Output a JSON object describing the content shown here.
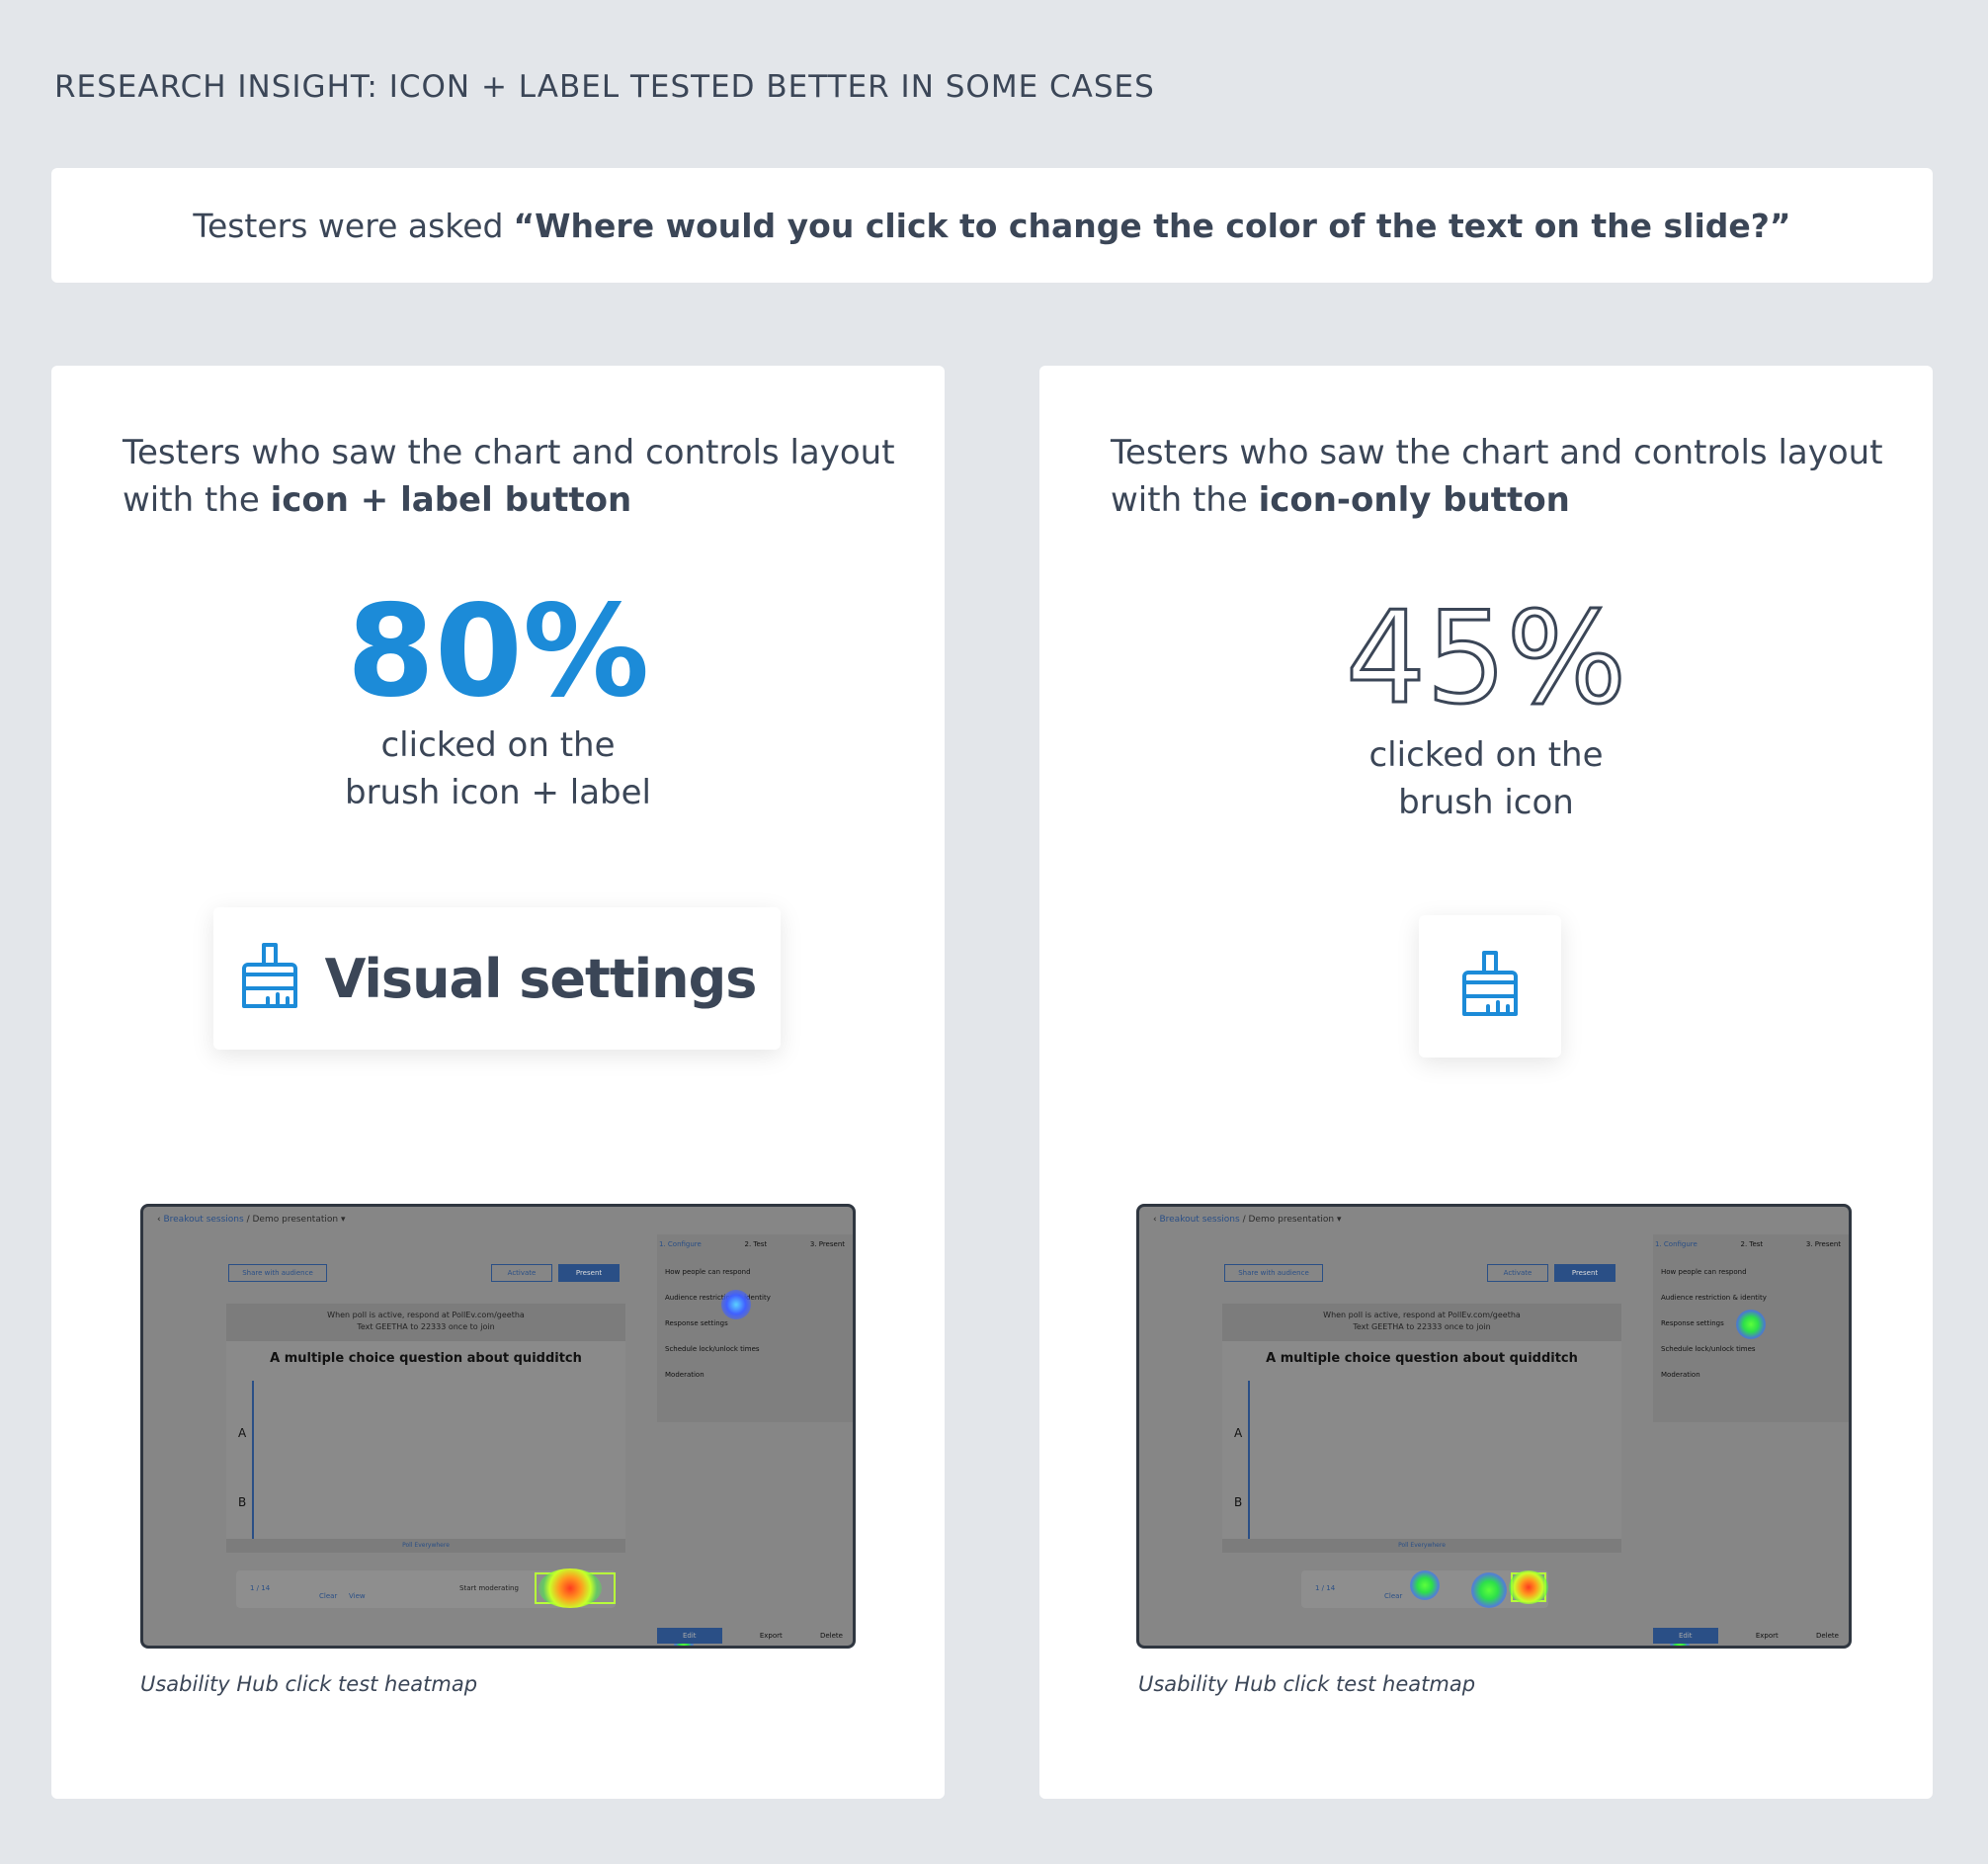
{
  "heading": "RESEARCH INSIGHT: ICON + LABEL TESTED BETTER IN SOME CASES",
  "question": {
    "prefix": "Testers were asked",
    "quote": "“Where would you click to change the color of the text on the slide?”"
  },
  "left_card": {
    "desc_prefix": "Testers who saw the chart and controls layout with the",
    "desc_bold": "icon + label button",
    "stat": "80%",
    "caption_line1": "clicked on the",
    "caption_line2": "brush icon + label",
    "button_label": "Visual settings",
    "heatmap_caption": "Usability Hub click test heatmap"
  },
  "right_card": {
    "desc_prefix": "Testers who saw the chart and controls layout with the",
    "desc_bold": "icon-only button",
    "stat": "45%",
    "caption_line1": "clicked on the",
    "caption_line2": "brush icon",
    "heatmap_caption": "Usability Hub click test heatmap"
  },
  "heatmap_screen": {
    "breadcrumb": "Breakout sessions",
    "breadcrumb_sep": "/",
    "presentation": "Demo presentation",
    "share": "Share with audience",
    "activate": "Activate",
    "present": "Present",
    "respond_line": "When poll is active, respond at PollEv.com/geetha",
    "text_line": "Text GEETHA to 22333 once to join",
    "question_title": "A multiple choice question about quidditch",
    "option_a": "A",
    "option_b": "B",
    "footer_brand": "Poll Everywhere",
    "steps": [
      "1. Configure",
      "2. Test",
      "3. Present"
    ],
    "panel_items": [
      "How people can respond",
      "Audience restriction & identity",
      "Response settings",
      "Schedule lock/unlock times",
      "Moderation"
    ],
    "pager": "1 / 14",
    "clear": "Clear",
    "view": "View",
    "start_moderating": "Start moderating",
    "edit": "Edit",
    "export": "Export",
    "delete": "Delete"
  },
  "colors": {
    "accent_blue": "#1c8bd8",
    "text_dark": "#3b4657",
    "background": "#e3e6ea"
  },
  "icons": [
    "brush-icon"
  ]
}
